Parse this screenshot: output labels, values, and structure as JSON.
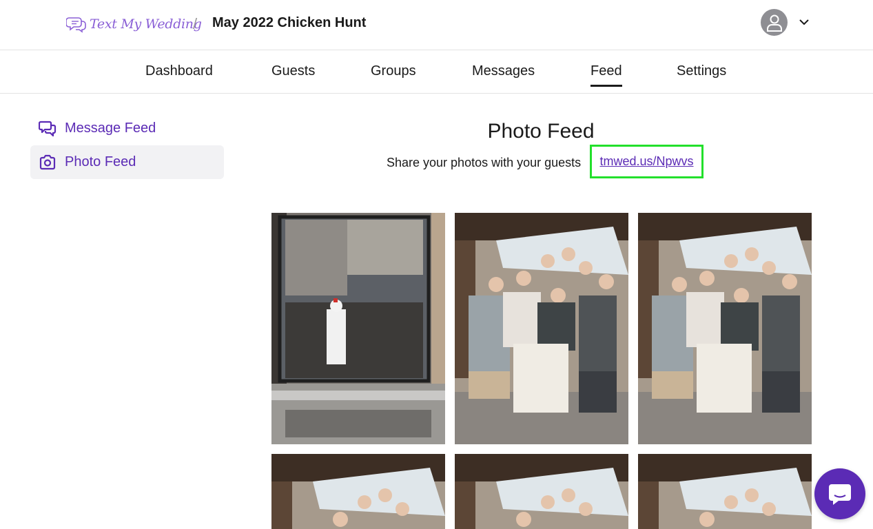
{
  "header": {
    "logo_text": "Text My Wedding",
    "separator": "/",
    "event_title": "May 2022 Chicken Hunt"
  },
  "nav": {
    "tabs": [
      {
        "label": "Dashboard"
      },
      {
        "label": "Guests"
      },
      {
        "label": "Groups"
      },
      {
        "label": "Messages"
      },
      {
        "label": "Feed",
        "active": true
      },
      {
        "label": "Settings"
      }
    ]
  },
  "sidebar": {
    "items": [
      {
        "label": "Message Feed",
        "icon": "chat-bubbles-icon"
      },
      {
        "label": "Photo Feed",
        "icon": "camera-icon",
        "active": true
      }
    ]
  },
  "main": {
    "title": "Photo Feed",
    "share_text": "Share your photos with your guests",
    "share_link": "tmwed.us/Npwvs"
  },
  "photos": [
    {
      "alt": "window-selfie-chicken-costume"
    },
    {
      "alt": "group-photo"
    },
    {
      "alt": "group-photo"
    },
    {
      "alt": "group-photo"
    },
    {
      "alt": "group-photo"
    },
    {
      "alt": "group-photo"
    }
  ],
  "colors": {
    "accent": "#5b2bb5",
    "logo": "#8a5fd6",
    "highlight": "#22e02b",
    "active_bg": "#f2f2f4"
  }
}
